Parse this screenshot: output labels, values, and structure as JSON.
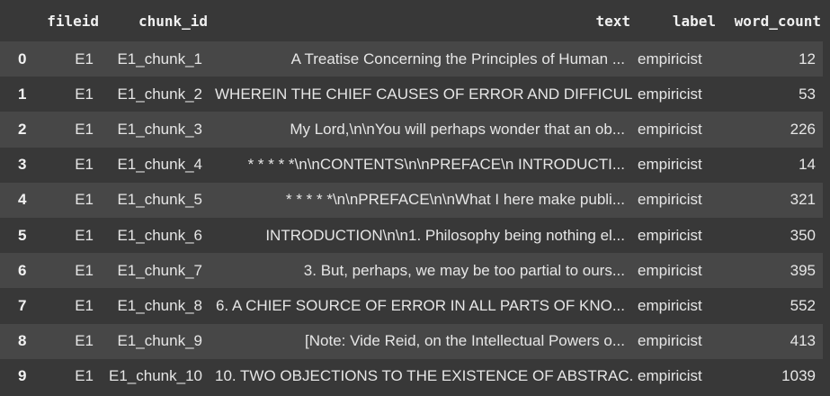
{
  "table": {
    "columns": [
      "fileid",
      "chunk_id",
      "text",
      "label",
      "word_count"
    ],
    "rows": [
      {
        "index": "0",
        "fileid": "E1",
        "chunk_id": "E1_chunk_1",
        "text": "A Treatise Concerning the Principles of Human ...",
        "label": "empiricist",
        "word_count": "12"
      },
      {
        "index": "1",
        "fileid": "E1",
        "chunk_id": "E1_chunk_2",
        "text": "WHEREIN THE CHIEF CAUSES OF ERROR AND DIFFICUL...",
        "label": "empiricist",
        "word_count": "53"
      },
      {
        "index": "2",
        "fileid": "E1",
        "chunk_id": "E1_chunk_3",
        "text": "My Lord,\\n\\nYou will perhaps wonder that an ob...",
        "label": "empiricist",
        "word_count": "226"
      },
      {
        "index": "3",
        "fileid": "E1",
        "chunk_id": "E1_chunk_4",
        "text": "* * * * *\\n\\nCONTENTS\\n\\nPREFACE\\n INTRODUCTI...",
        "label": "empiricist",
        "word_count": "14"
      },
      {
        "index": "4",
        "fileid": "E1",
        "chunk_id": "E1_chunk_5",
        "text": "* * * * *\\n\\nPREFACE\\n\\nWhat I here make publi...",
        "label": "empiricist",
        "word_count": "321"
      },
      {
        "index": "5",
        "fileid": "E1",
        "chunk_id": "E1_chunk_6",
        "text": "INTRODUCTION\\n\\n1. Philosophy being nothing el...",
        "label": "empiricist",
        "word_count": "350"
      },
      {
        "index": "6",
        "fileid": "E1",
        "chunk_id": "E1_chunk_7",
        "text": "3. But, perhaps, we may be too partial to ours...",
        "label": "empiricist",
        "word_count": "395"
      },
      {
        "index": "7",
        "fileid": "E1",
        "chunk_id": "E1_chunk_8",
        "text": "6. A CHIEF SOURCE OF ERROR IN ALL PARTS OF KNO...",
        "label": "empiricist",
        "word_count": "552"
      },
      {
        "index": "8",
        "fileid": "E1",
        "chunk_id": "E1_chunk_9",
        "text": "[Note: Vide Reid, on the Intellectual Powers o...",
        "label": "empiricist",
        "word_count": "413"
      },
      {
        "index": "9",
        "fileid": "E1",
        "chunk_id": "E1_chunk_10",
        "text": "10. TWO OBJECTIONS TO THE EXISTENCE OF ABSTRAC...",
        "label": "empiricist",
        "word_count": "1039"
      }
    ]
  }
}
